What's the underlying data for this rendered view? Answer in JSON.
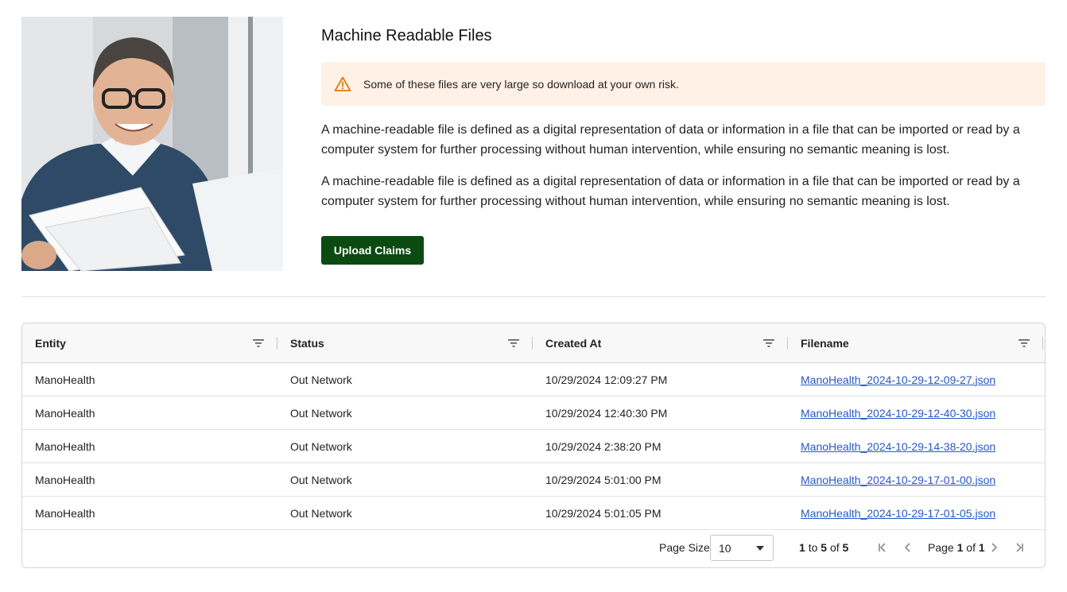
{
  "page": {
    "title": "Machine Readable Files",
    "alert": "Some of these files are very large so download at your own risk.",
    "paragraphs": [
      "A machine-readable file is defined as a digital representation of data or information in a file that can be imported or read by a computer system for further processing without human intervention, while ensuring no semantic meaning is lost.",
      "A machine-readable file is defined as a digital representation of data or information in a file that can be imported or read by a computer system for further processing without human intervention, while ensuring no semantic meaning is lost."
    ],
    "upload_label": "Upload Claims",
    "photo_icon": "man-with-laptop-photo",
    "accent_color": "#0b4a10",
    "alert_bg": "#fff1e5",
    "alert_icon_color": "#e07b12",
    "link_color": "#2a57c7"
  },
  "grid": {
    "columns": [
      "Entity",
      "Status",
      "Created At",
      "Filename"
    ],
    "rows": [
      {
        "entity": "ManoHealth",
        "status": "Out Network",
        "created": "10/29/2024 12:09:27 PM",
        "filename": "ManoHealth_2024-10-29-12-09-27.json"
      },
      {
        "entity": "ManoHealth",
        "status": "Out Network",
        "created": "10/29/2024 12:40:30 PM",
        "filename": "ManoHealth_2024-10-29-12-40-30.json"
      },
      {
        "entity": "ManoHealth",
        "status": "Out Network",
        "created": "10/29/2024 2:38:20 PM",
        "filename": "ManoHealth_2024-10-29-14-38-20.json"
      },
      {
        "entity": "ManoHealth",
        "status": "Out Network",
        "created": "10/29/2024 5:01:00 PM",
        "filename": "ManoHealth_2024-10-29-17-01-00.json"
      },
      {
        "entity": "ManoHealth",
        "status": "Out Network",
        "created": "10/29/2024 5:01:05 PM",
        "filename": "ManoHealth_2024-10-29-17-01-05.json"
      }
    ],
    "footer": {
      "page_size_label": "Page Size:",
      "page_size_value": "10",
      "range_start": "1",
      "range_to": "to",
      "range_end": "5",
      "range_of": "of",
      "range_total": "5",
      "page_word": "Page",
      "page_current": "1",
      "page_of": "of",
      "page_total": "1"
    }
  }
}
